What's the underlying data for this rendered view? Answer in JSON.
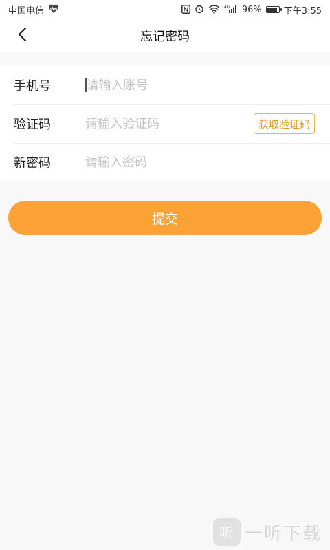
{
  "status_bar": {
    "carrier": "中国电信",
    "network": "4G",
    "battery": "96%",
    "battery_level": 0.96,
    "time": "下午3:55"
  },
  "nav": {
    "title": "忘记密码",
    "back_icon": "chevron-left-icon"
  },
  "form": {
    "phone": {
      "label": "手机号",
      "placeholder": "请输入账号",
      "value": ""
    },
    "code": {
      "label": "验证码",
      "placeholder": "请输入验证码",
      "value": "",
      "button_label": "获取验证码"
    },
    "password": {
      "label": "新密码",
      "placeholder": "请输入密码",
      "value": ""
    }
  },
  "submit_label": "提交",
  "watermark": {
    "text": "一听下载"
  },
  "colors": {
    "accent": "#ffa236",
    "code_button": "#e8b54f",
    "background": "#f8f8f8"
  }
}
